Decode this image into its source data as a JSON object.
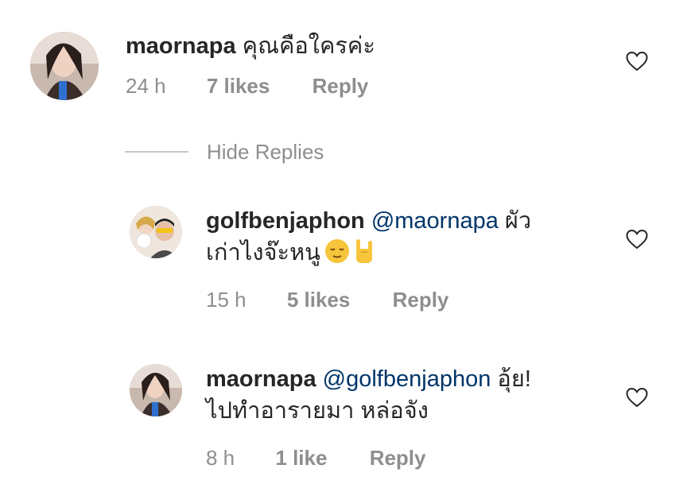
{
  "comments": [
    {
      "username": "maornapa",
      "mention": "",
      "text": "คุณคือใครค่ะ",
      "time": "24 h",
      "likes": "7 likes",
      "reply": "Reply",
      "emoji": []
    },
    {
      "username": "golfbenjaphon",
      "mention": "@maornapa",
      "text_line1": "ผัว",
      "text_line2": "เก่าไงจ๊ะหนู",
      "time": "15 h",
      "likes": "5 likes",
      "reply": "Reply",
      "emoji": [
        "relieved-face-emoji",
        "rock-on-hand-emoji"
      ]
    },
    {
      "username": "maornapa",
      "mention": "@golfbenjaphon",
      "text_line1": "อุ้ย!",
      "text_line2": "ไปทำอารายมา หล่อจัง",
      "time": "8 h",
      "likes": "1 like",
      "reply": "Reply",
      "emoji": []
    }
  ],
  "hide_replies_label": "Hide Replies",
  "colors": {
    "text": "#262626",
    "meta": "#8e8e8e",
    "mention": "#003569",
    "divider": "#c7c7c7"
  },
  "icons": {
    "like": "heart-icon"
  }
}
